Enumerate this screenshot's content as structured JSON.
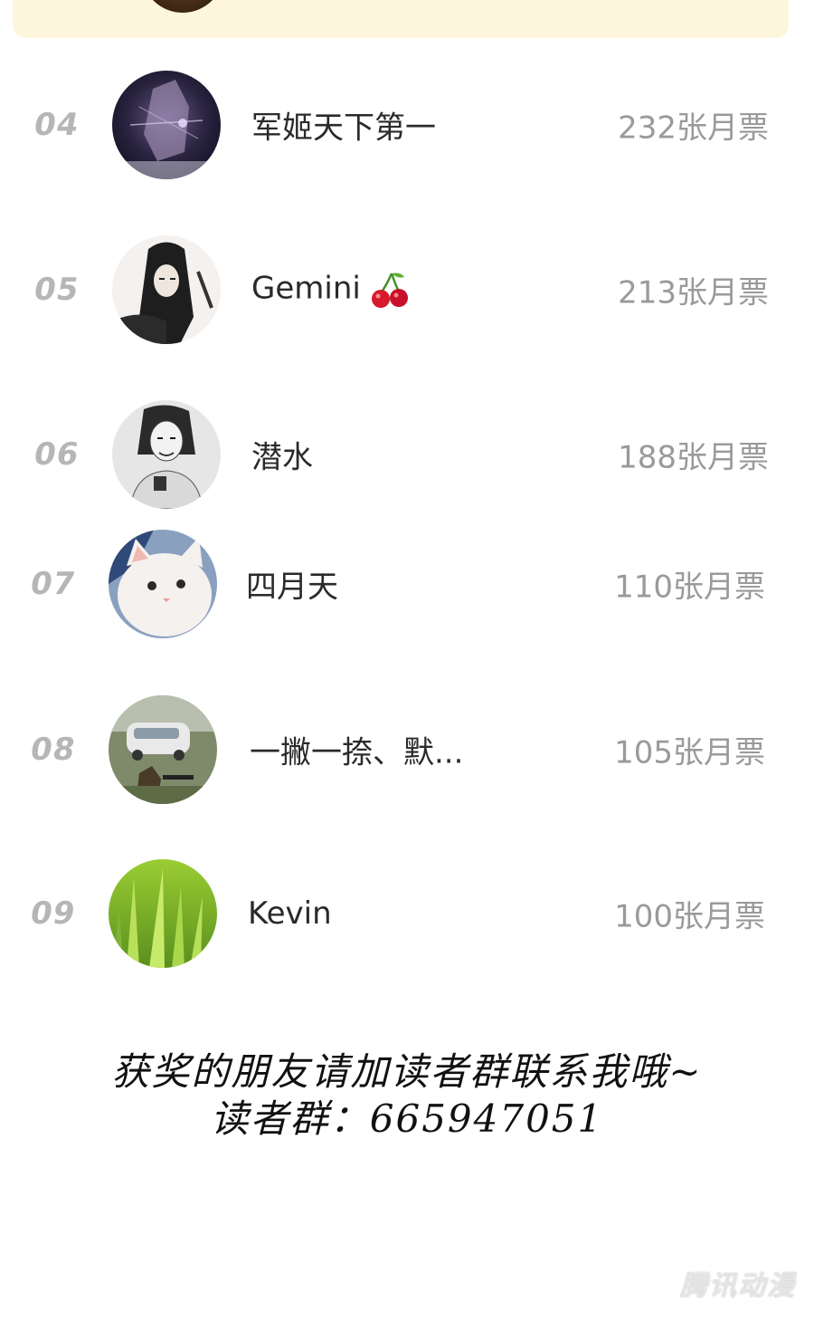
{
  "leaderboard": {
    "rows": [
      {
        "rank": "04",
        "name": "军姬天下第一",
        "votes": "232张月票",
        "avatar_icon": "avatar-dark-anime-icon"
      },
      {
        "rank": "05",
        "name": "Gemini",
        "votes": "213张月票",
        "avatar_icon": "avatar-long-hair-sketch-icon",
        "emoji": "cherry-icon"
      },
      {
        "rank": "06",
        "name": "潜水",
        "votes": "188张月票",
        "avatar_icon": "avatar-bw-portrait-icon"
      },
      {
        "rank": "07",
        "name": "四月天",
        "votes": "110张月票",
        "avatar_icon": "avatar-white-cat-icon"
      },
      {
        "rank": "08",
        "name": "一撇一捺、默...",
        "votes": "105张月票",
        "avatar_icon": "avatar-game-scene-icon"
      },
      {
        "rank": "09",
        "name": "Kevin",
        "votes": "100张月票",
        "avatar_icon": "avatar-green-grass-icon"
      }
    ]
  },
  "footer": {
    "line1": "获奖的朋友请加读者群联系我哦~",
    "line2": "读者群：665947051"
  },
  "watermark": {
    "text": "腾讯动漫"
  },
  "colors": {
    "top_card_bg": "#fdf6dc",
    "rank_color": "#b6b6b6",
    "votes_color": "#9a9a9a"
  }
}
